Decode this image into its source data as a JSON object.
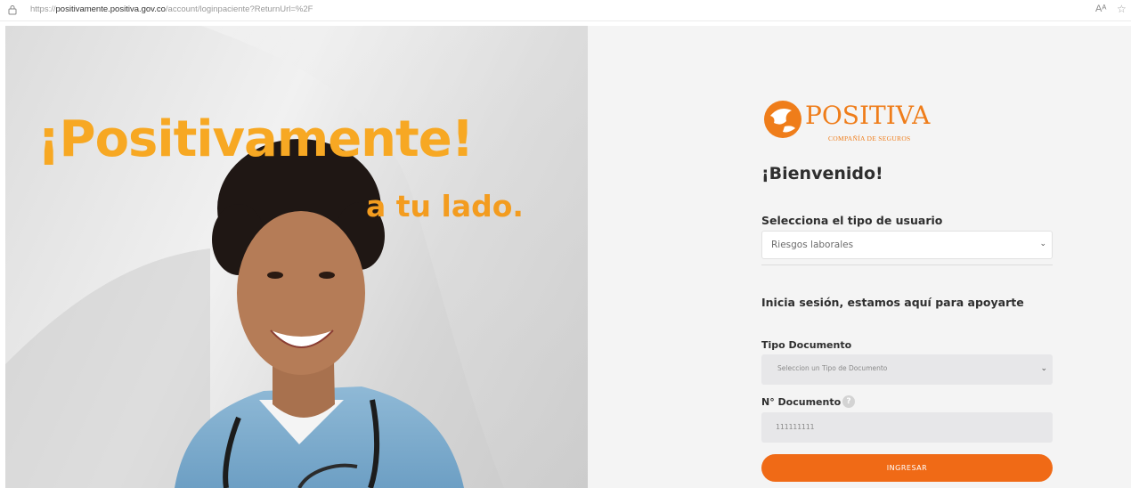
{
  "browser": {
    "url_prefix": "https://",
    "url_host": "positivamente.positiva.gov.co",
    "url_path": "/account/loginpaciente?ReturnUrl=%2F",
    "read_aloud_label": "Aᴬ",
    "favorite_icon": "star-plus-icon"
  },
  "hero": {
    "title": "¡Positivamente!",
    "subtitle": "a tu lado."
  },
  "brand": {
    "name": "POSITIVA",
    "tagline": "COMPAÑÍA DE SEGUROS",
    "color": "#ef7d1a"
  },
  "form": {
    "welcome": "¡Bienvenido!",
    "user_type_label": "Selecciona el tipo de usuario",
    "user_type_value": "Riesgos laborales",
    "login_prompt": "Inicia sesión, estamos aquí para apoyarte",
    "doc_type_label": "Tipo Documento",
    "doc_type_placeholder": "Seleccion un Tipo de Documento",
    "doc_number_label": "N° Documento",
    "doc_number_help": "?",
    "doc_number_value": "111111111",
    "submit_label": "INGRESAR",
    "accent": "#f06a16"
  }
}
